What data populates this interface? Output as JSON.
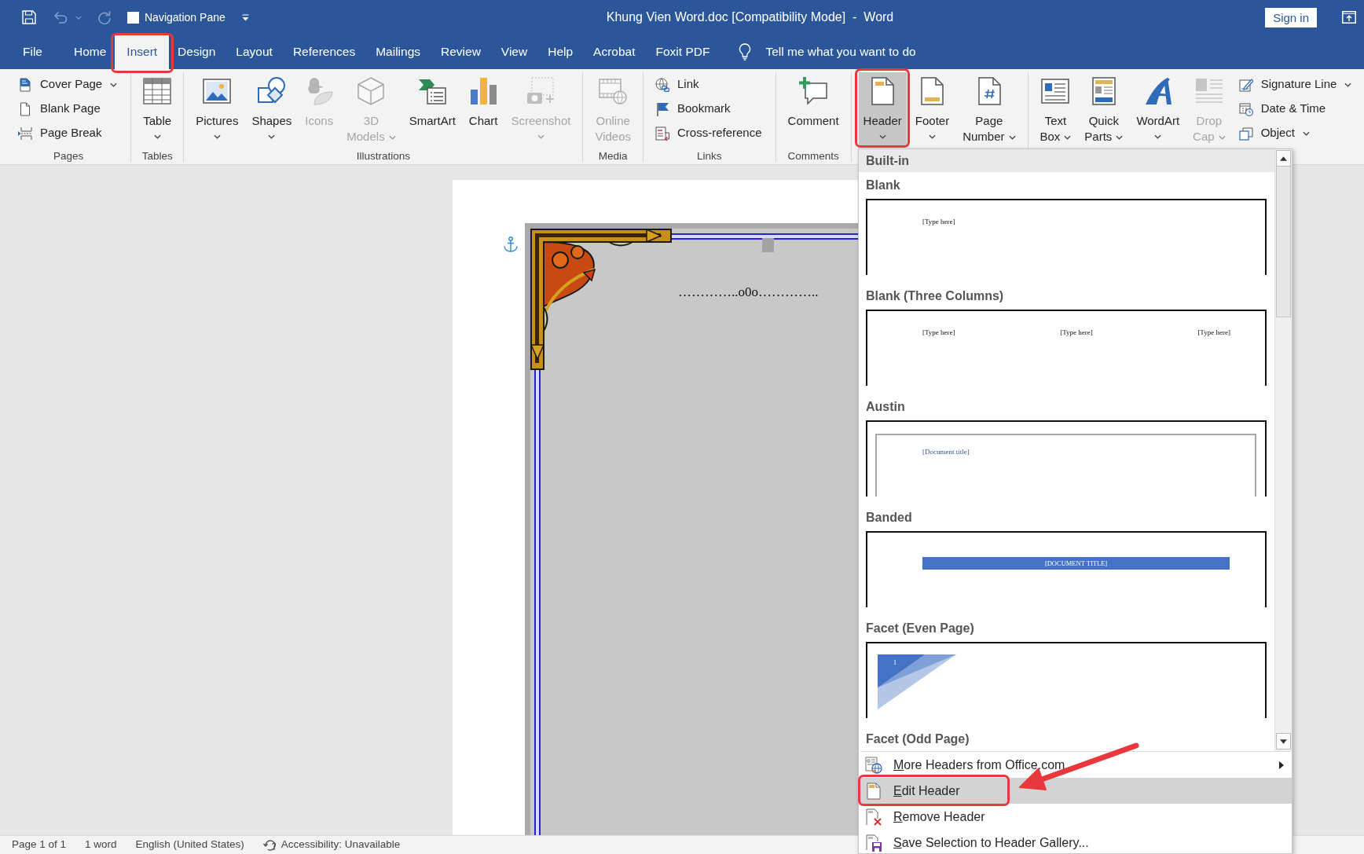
{
  "title_bar": {
    "quick_access": {
      "save": {
        "disabled": false
      },
      "undo": {
        "disabled": true
      },
      "redo": {
        "disabled": true
      }
    },
    "navigation_pane": {
      "label": "Navigation Pane",
      "checked": false
    },
    "title": "Khung Vien Word.doc [Compatibility Mode]  -  Word",
    "sign_in": "Sign in"
  },
  "tabs": [
    {
      "label": "File",
      "selected": false,
      "highlighted": false
    },
    {
      "label": "Home",
      "selected": false,
      "highlighted": false
    },
    {
      "label": "Insert",
      "selected": true,
      "highlighted": true
    },
    {
      "label": "Design",
      "selected": false,
      "highlighted": false
    },
    {
      "label": "Layout",
      "selected": false,
      "highlighted": false
    },
    {
      "label": "References",
      "selected": false,
      "highlighted": false
    },
    {
      "label": "Mailings",
      "selected": false,
      "highlighted": false
    },
    {
      "label": "Review",
      "selected": false,
      "highlighted": false
    },
    {
      "label": "View",
      "selected": false,
      "highlighted": false
    },
    {
      "label": "Help",
      "selected": false,
      "highlighted": false
    },
    {
      "label": "Acrobat",
      "selected": false,
      "highlighted": false
    },
    {
      "label": "Foxit PDF",
      "selected": false,
      "highlighted": false
    }
  ],
  "tell_me": {
    "placeholder": "Tell me what you want to do"
  },
  "ribbon": [
    {
      "label": "Pages",
      "items": [
        {
          "kind": "small",
          "label": "Cover Page",
          "dropdown": true,
          "disabled": false,
          "expanded": false,
          "highlighted": false
        },
        {
          "kind": "small",
          "label": "Blank Page",
          "dropdown": false,
          "disabled": false,
          "expanded": false,
          "highlighted": false
        },
        {
          "kind": "small",
          "label": "Page Break",
          "dropdown": false,
          "disabled": false,
          "expanded": false,
          "highlighted": false
        }
      ]
    },
    {
      "label": "Tables",
      "items": [
        {
          "kind": "large",
          "label": "Table",
          "dropdown": true,
          "disabled": false,
          "expanded": false,
          "highlighted": false
        }
      ]
    },
    {
      "label": "Illustrations",
      "items": [
        {
          "kind": "large",
          "label": "Pictures",
          "dropdown": true,
          "disabled": false,
          "expanded": false,
          "highlighted": false
        },
        {
          "kind": "large",
          "label": "Shapes",
          "dropdown": true,
          "disabled": false,
          "expanded": false,
          "highlighted": false
        },
        {
          "kind": "large",
          "label": "Icons",
          "dropdown": false,
          "disabled": true,
          "expanded": false,
          "highlighted": false
        },
        {
          "kind": "large",
          "label": "3D Models",
          "dropdown": true,
          "disabled": true,
          "expanded": false,
          "highlighted": false
        },
        {
          "kind": "large",
          "label": "SmartArt",
          "dropdown": false,
          "disabled": false,
          "expanded": false,
          "highlighted": false
        },
        {
          "kind": "large",
          "label": "Chart",
          "dropdown": false,
          "disabled": false,
          "expanded": false,
          "highlighted": false
        },
        {
          "kind": "large",
          "label": "Screenshot",
          "dropdown": true,
          "disabled": true,
          "expanded": false,
          "highlighted": false
        }
      ]
    },
    {
      "label": "Media",
      "items": [
        {
          "kind": "large",
          "label": "Online Videos",
          "dropdown": false,
          "disabled": true,
          "expanded": false,
          "highlighted": false
        }
      ]
    },
    {
      "label": "Links",
      "items": [
        {
          "kind": "small",
          "label": "Link",
          "dropdown": false,
          "disabled": false,
          "expanded": false,
          "highlighted": false
        },
        {
          "kind": "small",
          "label": "Bookmark",
          "dropdown": false,
          "disabled": false,
          "expanded": false,
          "highlighted": false
        },
        {
          "kind": "small",
          "label": "Cross-reference",
          "dropdown": false,
          "disabled": false,
          "expanded": false,
          "highlighted": false
        }
      ]
    },
    {
      "label": "Comments",
      "items": [
        {
          "kind": "large",
          "label": "Comment",
          "dropdown": false,
          "disabled": false,
          "expanded": false,
          "highlighted": false
        }
      ]
    },
    {
      "items": [
        {
          "kind": "large",
          "label": "Header",
          "dropdown": true,
          "disabled": false,
          "expanded": true,
          "highlighted": true
        },
        {
          "kind": "large",
          "label": "Footer",
          "dropdown": true,
          "disabled": false,
          "expanded": false,
          "highlighted": false
        },
        {
          "kind": "large",
          "label": "Page Number",
          "dropdown": true,
          "disabled": false,
          "expanded": false,
          "highlighted": false
        }
      ]
    },
    {
      "items": [
        {
          "kind": "large",
          "label": "Text Box",
          "dropdown": true,
          "disabled": false,
          "expanded": false,
          "highlighted": false
        },
        {
          "kind": "large",
          "label": "Quick Parts",
          "dropdown": true,
          "disabled": false,
          "expanded": false,
          "highlighted": false
        },
        {
          "kind": "large",
          "label": "WordArt",
          "dropdown": true,
          "disabled": false,
          "expanded": false,
          "highlighted": false
        },
        {
          "kind": "large",
          "label": "Drop Cap",
          "dropdown": true,
          "disabled": true,
          "expanded": false,
          "highlighted": false
        },
        {
          "kind": "small",
          "label": "Signature Line",
          "dropdown": true,
          "disabled": false,
          "expanded": false,
          "highlighted": false
        },
        {
          "kind": "small",
          "label": "Date & Time",
          "dropdown": false,
          "disabled": false,
          "expanded": false,
          "highlighted": false
        },
        {
          "kind": "small",
          "label": "Object",
          "dropdown": true,
          "disabled": false,
          "expanded": false,
          "highlighted": false
        }
      ]
    }
  ],
  "header_menu": {
    "section": "Built-in",
    "gallery": [
      {
        "name": "Blank",
        "kind": "plain",
        "texts": [
          "[Type here]"
        ]
      },
      {
        "name": "Blank (Three Columns)",
        "kind": "plain",
        "texts": [
          "[Type here]",
          "[Type here]",
          "[Type here]"
        ]
      },
      {
        "name": "Austin",
        "kind": "framed",
        "texts": [
          "[Document title]"
        ]
      },
      {
        "name": "Banded",
        "kind": "band",
        "texts": [
          "[DOCUMENT TITLE]"
        ]
      },
      {
        "name": "Facet (Even Page)",
        "kind": "facet",
        "texts": [
          "1"
        ]
      },
      {
        "name": "Facet (Odd Page)",
        "kind": "none"
      }
    ],
    "commands": [
      {
        "label": "More Headers from Office.com",
        "submenu": true,
        "selected": false,
        "highlighted": false
      },
      {
        "label": "Edit Header",
        "submenu": false,
        "selected": true,
        "highlighted": true
      },
      {
        "label": "Remove Header",
        "submenu": false,
        "selected": false,
        "highlighted": false
      },
      {
        "label": "Save Selection to Header Gallery...",
        "submenu": false,
        "selected": false,
        "highlighted": false
      }
    ]
  },
  "document": {
    "text": "…………..o0o………….."
  },
  "status_bar": [
    {
      "kind": "text",
      "label": "Page 1 of 1"
    },
    {
      "kind": "text",
      "label": "1 word"
    },
    {
      "kind": "text",
      "label": "English (United States)"
    },
    {
      "kind": "accessibility",
      "label": "Accessibility: Unavailable"
    }
  ]
}
